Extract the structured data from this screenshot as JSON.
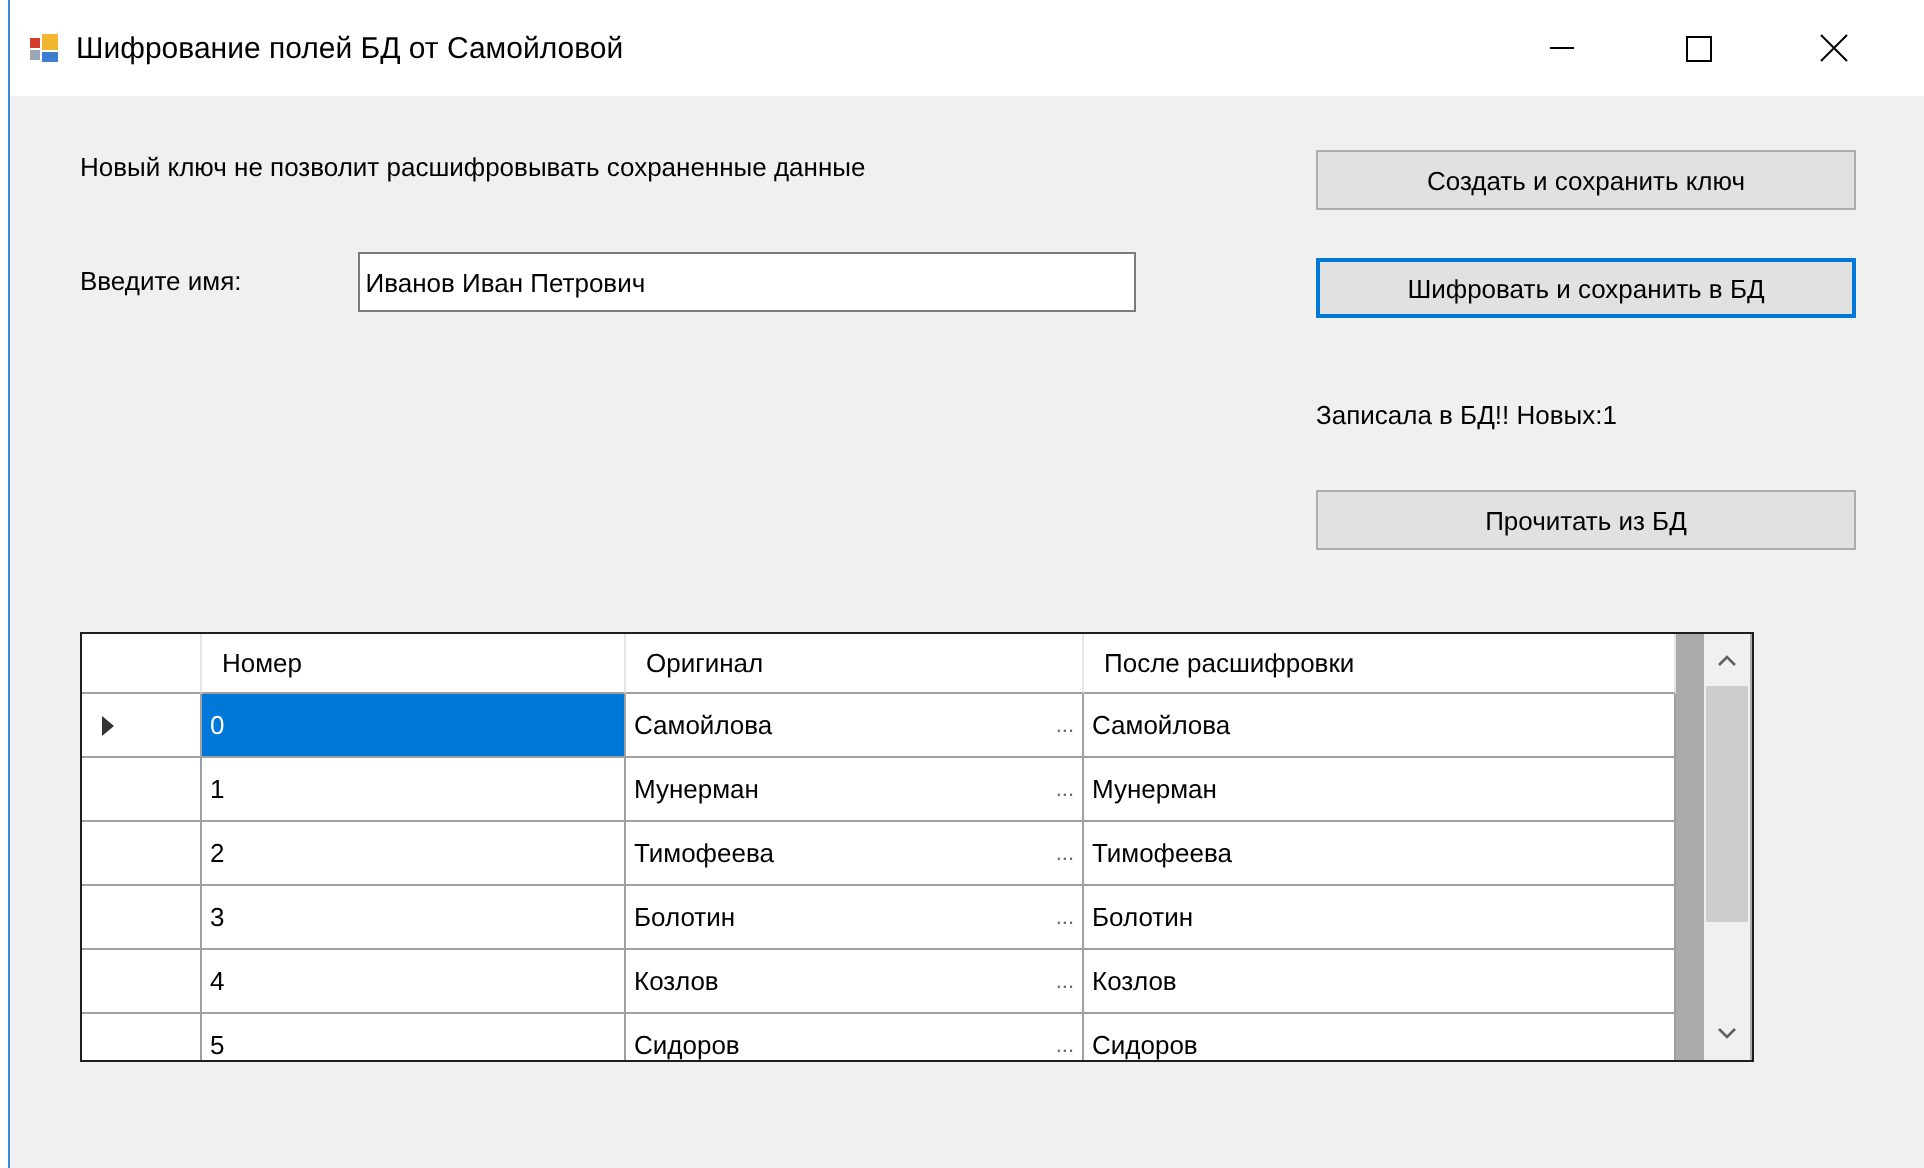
{
  "window": {
    "title": "Шифрование полей БД от Самойловой"
  },
  "notice": "Новый ключ не позволит расшифровывать сохраненные данные",
  "name_field": {
    "label": "Введите имя:",
    "value": "Иванов Иван Петрович"
  },
  "buttons": [
    {
      "label": "Создать и сохранить ключ",
      "focused": false
    },
    {
      "label": "Шифровать и сохранить в БД",
      "focused": true
    },
    {
      "label": "Прочитать из БД",
      "focused": false
    }
  ],
  "status": "Записала в БД!! Новых:1",
  "table": {
    "columns": [
      "Номер",
      "Оригинал",
      "После расшифровки"
    ],
    "rows": [
      {
        "number": "0",
        "original": "Самойлова",
        "overflow": "...",
        "decrypted": "Самойлова",
        "selected": true
      },
      {
        "number": "1",
        "original": "Мунерман",
        "overflow": "...",
        "decrypted": "Мунерман",
        "selected": false
      },
      {
        "number": "2",
        "original": "Тимофеева",
        "overflow": "...",
        "decrypted": "Тимофеева",
        "selected": false
      },
      {
        "number": "3",
        "original": "Болотин",
        "overflow": "...",
        "decrypted": "Болотин",
        "selected": false
      },
      {
        "number": "4",
        "original": "Козлов",
        "overflow": "...",
        "decrypted": "Козлов",
        "selected": false
      },
      {
        "number": "5",
        "original": "Сидоров",
        "overflow": "...",
        "decrypted": "Сидоров",
        "selected": false
      }
    ]
  }
}
